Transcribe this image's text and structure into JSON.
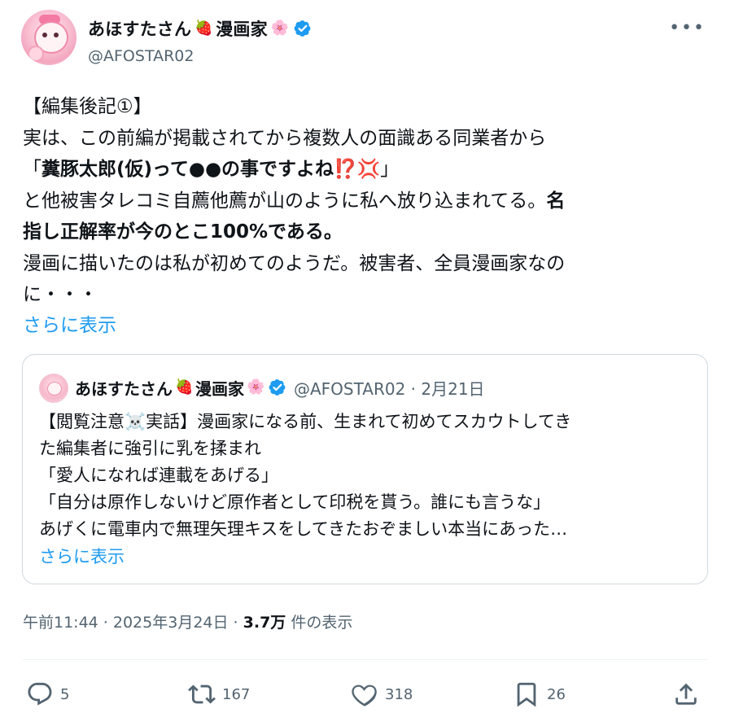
{
  "author": {
    "display_name": "あほすたさん",
    "name_suffix": "漫画家",
    "emoji_strawberry": "🍓",
    "emoji_blossom": "🌸",
    "handle": "@AFOSTAR02"
  },
  "tweet": {
    "lines": [
      "【編集後記①】",
      "実は、この前編が掲載されてから複数人の面識ある同業者から",
      "と他被害タレコミ自薦他薦が山のように私へ放り込まれてる。",
      "漫画に描いたのは私が初めてのようだ。被害者、全員漫画家なの",
      "に・・・"
    ],
    "quote_open": "「",
    "bold_quote": "糞豚太郎(仮)って●●の事ですよね",
    "emoji_exclaim": "⁉️",
    "emoji_anger": "💢",
    "quote_close": "」",
    "bold_tail_1": "名",
    "bold_tail_2": "指し正解率が今のとこ100%である。",
    "show_more": "さらに表示"
  },
  "quoted": {
    "display_name": "あほすたさん",
    "name_suffix": "漫画家",
    "handle_date": "@AFOSTAR02 · 2月21日",
    "line1_before": "【閲覧注意",
    "emoji_skull": "☠️",
    "line1_after": "実話】漫画家になる前、生まれて初めてスカウトしてき",
    "lines": [
      "た編集者に強引に乳を揉まれ",
      "「愛人になれば連載をあげる」",
      "「自分は原作しないけど原作者として印税を貰う。誰にも言うな」",
      "あげくに電車内で無理矢理キスをしてきたおぞましい本当にあった…"
    ],
    "show_more": "さらに表示"
  },
  "meta": {
    "time_date": "午前11:44 · 2025年3月24日 · ",
    "views_count": "3.7万",
    "views_label": " 件の表示"
  },
  "actions": {
    "replies": "5",
    "reposts": "167",
    "likes": "318",
    "bookmarks": "26"
  },
  "colors": {
    "accent": "#1d9bf0",
    "text": "#0f1419",
    "muted": "#536471",
    "border": "#cfd9de"
  }
}
